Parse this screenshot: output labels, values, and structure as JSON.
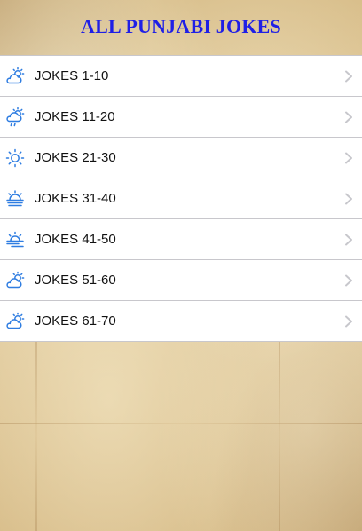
{
  "header": {
    "title": "ALL PUNJABI JOKES"
  },
  "colors": {
    "title": "#1f1fe6",
    "icon": "#2f7de1",
    "chevron": "#c7c7cc",
    "separator": "#c8c7cc"
  },
  "list": {
    "items": [
      {
        "label": "JOKES 1-10",
        "icon": "partly-cloudy-icon"
      },
      {
        "label": "JOKES 11-20",
        "icon": "cloud-rain-sun-icon"
      },
      {
        "label": "JOKES 21-30",
        "icon": "sun-icon"
      },
      {
        "label": "JOKES 31-40",
        "icon": "sun-fog-icon"
      },
      {
        "label": "JOKES 41-50",
        "icon": "sun-haze-icon"
      },
      {
        "label": "JOKES 51-60",
        "icon": "partly-cloudy-icon"
      },
      {
        "label": "JOKES 61-70",
        "icon": "partly-cloudy-icon"
      }
    ]
  }
}
